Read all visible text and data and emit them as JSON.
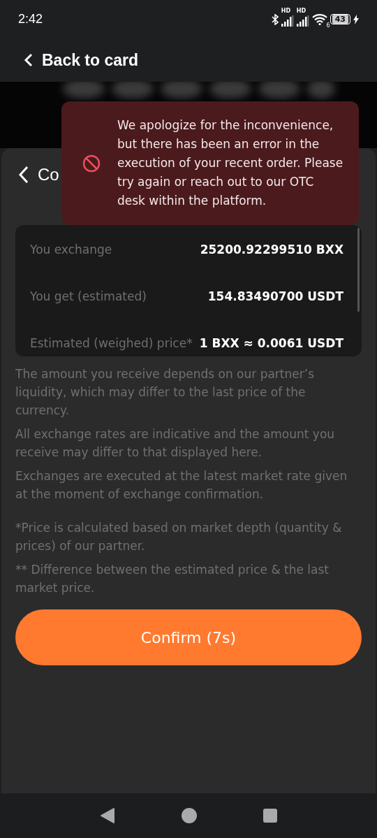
{
  "status_bar": {
    "time": "2:42",
    "signal_labels": [
      "HD",
      "HD"
    ],
    "wifi_label": "6",
    "battery": "43"
  },
  "header": {
    "back_label": "Back to card"
  },
  "sheet": {
    "title": "Co",
    "rows": [
      {
        "label": "You exchange",
        "value": "25200.92299510 BXX"
      },
      {
        "label": "You get (estimated)",
        "value": "154.83490700 USDT"
      },
      {
        "label": "Estimated (weighed) price*",
        "value": "1 BXX ≈ 0.0061 USDT"
      }
    ],
    "notes": [
      "The amount you receive depends on our partner’s liquidity, which may differ to the last price of the currency.",
      "All exchange rates are indicative and the amount you receive may differ to that displayed here.",
      "Exchanges are executed at the latest market rate given at the moment of exchange confirmation."
    ],
    "footnotes": [
      "*Price is calculated based on market depth (quantity & prices) of our partner.",
      "** Difference between the estimated price & the last market price."
    ],
    "confirm_button": "Confirm (7s)"
  },
  "toast": {
    "message": "We apologize for the inconvenience, but there has been an error in the execution of your recent order. Please try again or reach out to our OTC desk within the platform."
  }
}
